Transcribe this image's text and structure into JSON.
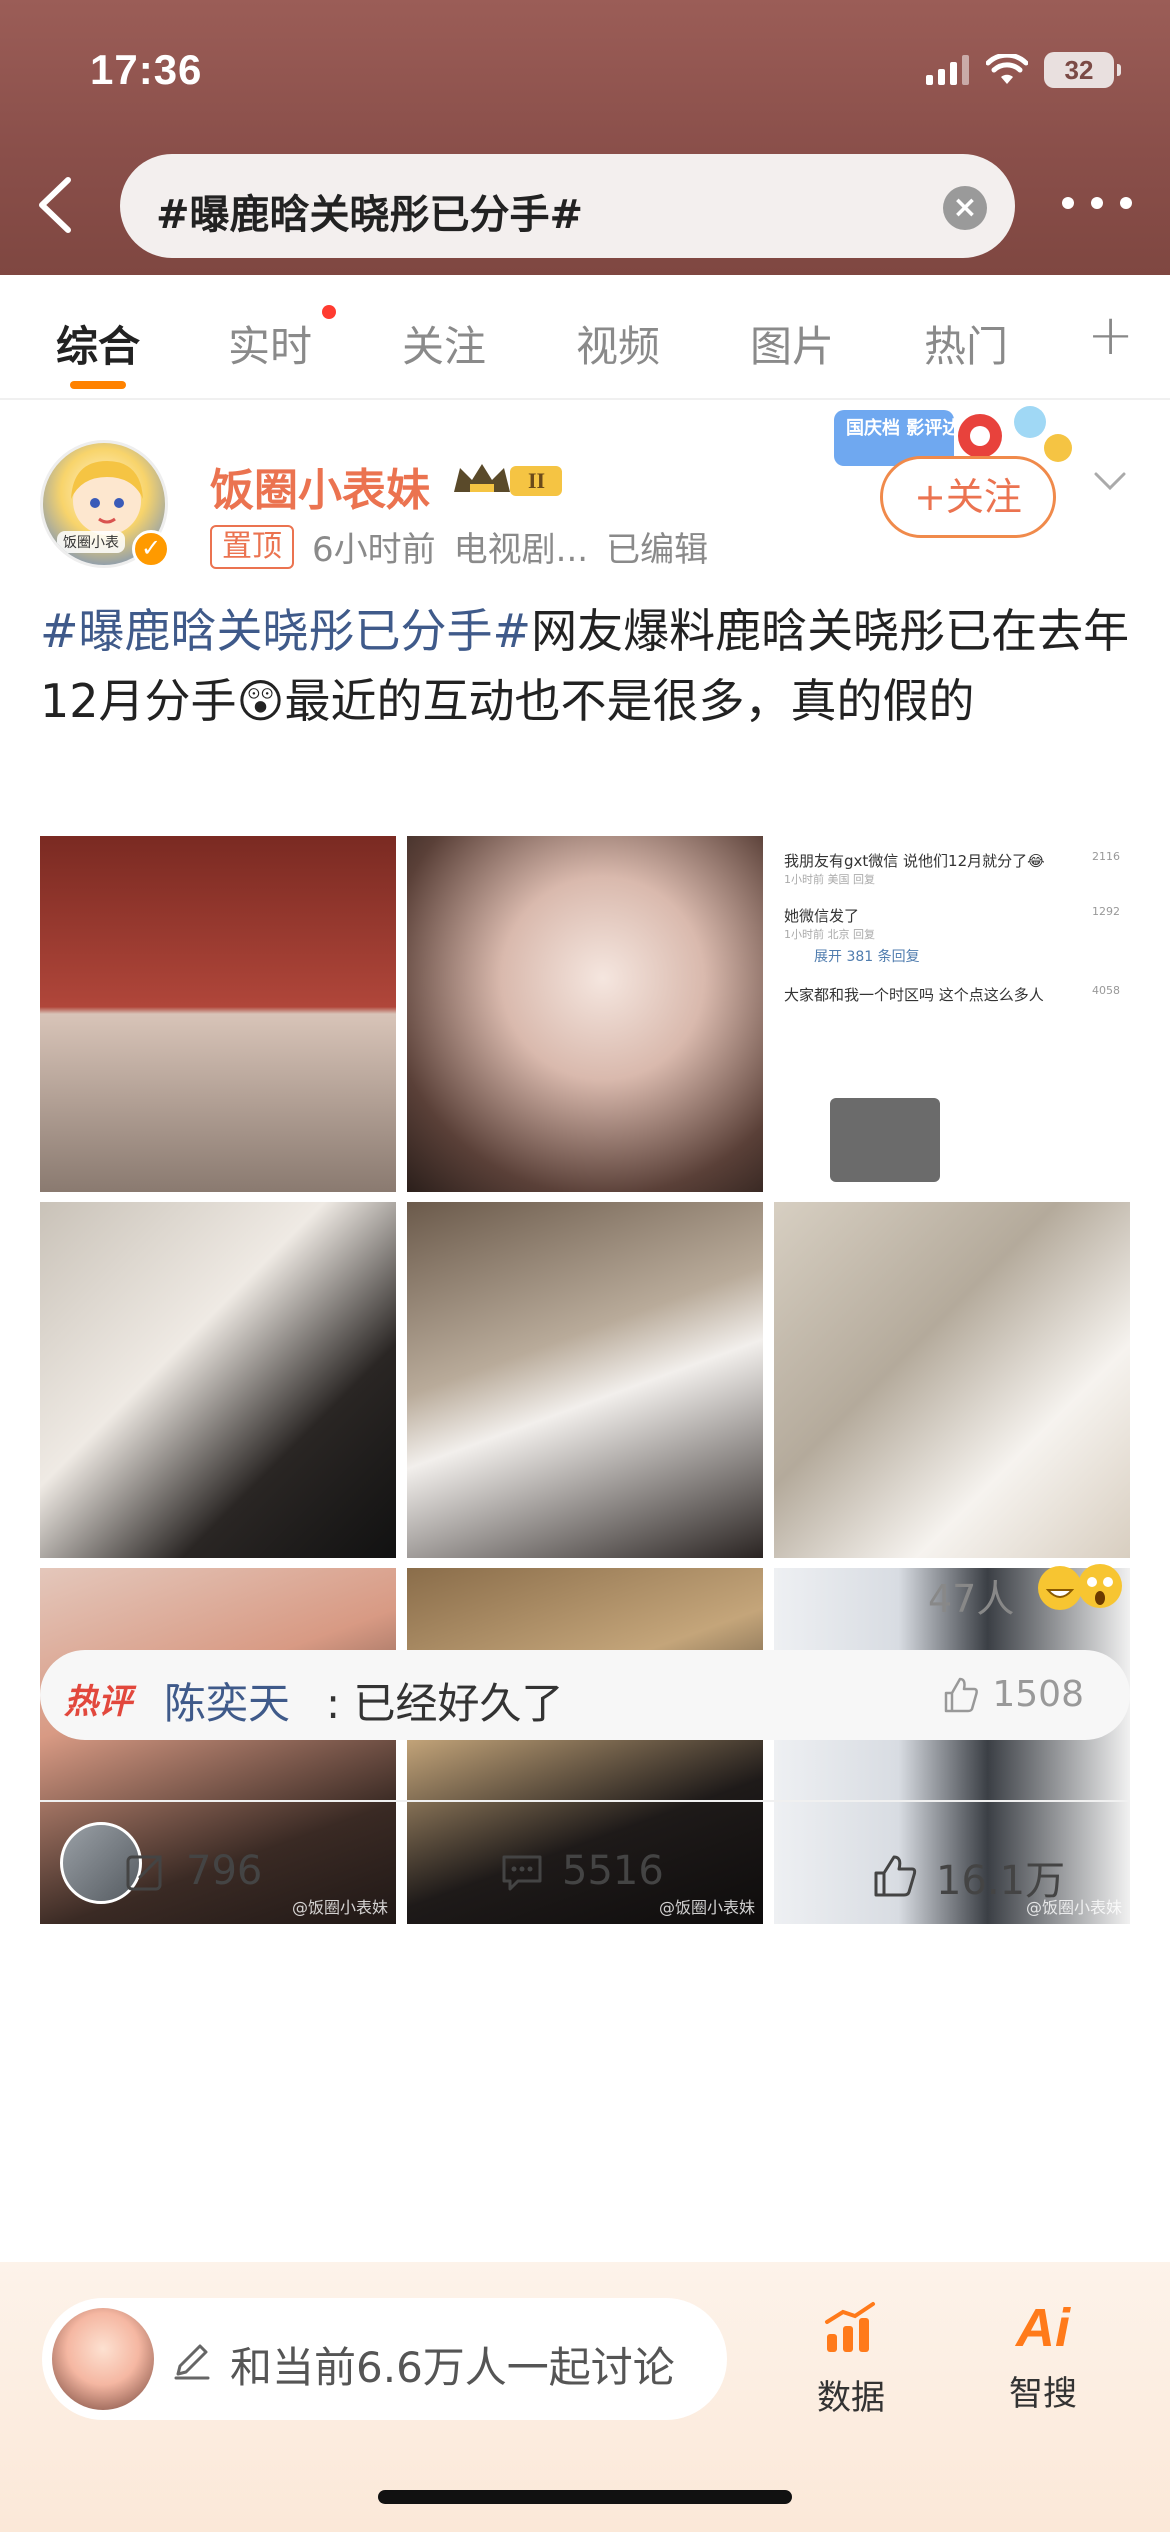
{
  "status_bar": {
    "time": "17:36",
    "battery": "32"
  },
  "search": {
    "query": "#曝鹿晗关晓彤已分手#"
  },
  "tabs": [
    {
      "label": "综合"
    },
    {
      "label": "实时"
    },
    {
      "label": "关注"
    },
    {
      "label": "视频"
    },
    {
      "label": "图片"
    },
    {
      "label": "热门"
    }
  ],
  "post": {
    "author": "饭圈小表妹",
    "avatar_text": "饭圈小表",
    "level_badge": "II",
    "pinned": "置顶",
    "time": "6小时前",
    "source": "电视剧...",
    "edited": "已编辑",
    "holiday_badge": "国庆档 影评达",
    "follow_label": "+关注",
    "hashtag": "#曝鹿晗关晓彤已分手#",
    "body": "网友爆料鹿晗关晓彤已在去年12月分手😲最近的互动也不是很多，真的假的"
  },
  "screenshot_comments": [
    {
      "text": "我朋友有gxt微信 说他们12月就分了😂",
      "meta": "1小时前 美国 回复",
      "likes": "2116"
    },
    {
      "text": "她微信发了",
      "meta": "1小时前 北京 回复",
      "likes": "1292"
    },
    {
      "text": "展开 381 条回复",
      "meta": "",
      "likes": ""
    },
    {
      "text": "大家都和我一个时区吗 这个点这么多人",
      "meta": "",
      "likes": "4058"
    }
  ],
  "image_watermarks": [
    "@饭圈小表妹",
    "@饭圈小表妹",
    "@饭圈小表妹"
  ],
  "reactions": {
    "count": "47人"
  },
  "hot_comment": {
    "badge": "热评",
    "user": "陈奕天",
    "text": ": 已经好久了",
    "likes": "1508"
  },
  "actions": {
    "reposts": "796",
    "comments": "5516",
    "likes": "16.1万"
  },
  "bottom": {
    "discuss_placeholder": "和当前6.6万人一起讨论",
    "data_label": "数据",
    "ai_label": "智搜",
    "ai_glyph": "Ai"
  },
  "colors": {
    "accent": "#ff8200",
    "link": "#3f5a8a",
    "username": "#eb7350"
  }
}
